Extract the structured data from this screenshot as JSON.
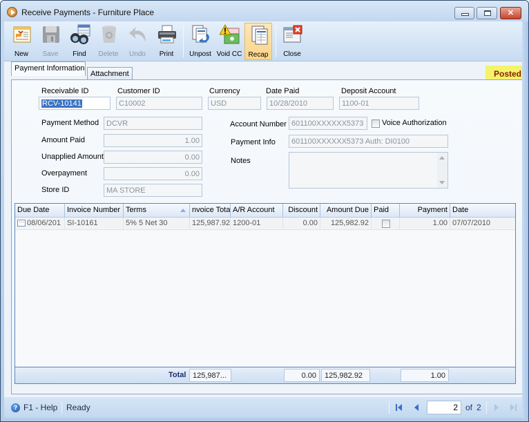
{
  "window": {
    "title": "Receive Payments - Furniture Place",
    "buttons": {
      "minimize": "minimize",
      "maximize": "maximize",
      "close": "close"
    }
  },
  "toolbar": {
    "items": [
      {
        "label": "New",
        "icon": "new-icon",
        "enabled": true
      },
      {
        "label": "Save",
        "icon": "save-icon",
        "enabled": false
      },
      {
        "label": "Find",
        "icon": "find-binoculars-icon",
        "enabled": true
      },
      {
        "label": "Delete",
        "icon": "delete-trash-icon",
        "enabled": false
      },
      {
        "label": "Undo",
        "icon": "undo-icon",
        "enabled": false
      },
      {
        "label": "Print",
        "icon": "print-icon",
        "enabled": true
      },
      {
        "label": "Unpost",
        "icon": "unpost-icon",
        "enabled": true
      },
      {
        "label": "Void CC",
        "icon": "void-cc-warning-icon",
        "enabled": true
      },
      {
        "label": "Recap",
        "icon": "recap-icon",
        "enabled": true,
        "active": true
      },
      {
        "label": "Close",
        "icon": "close-form-icon",
        "enabled": true
      }
    ]
  },
  "tabs": [
    {
      "label": "Payment Information",
      "selected": true
    },
    {
      "label": "Attachment",
      "selected": false
    }
  ],
  "status_badge": "Posted",
  "form": {
    "receivable_id": {
      "label": "Receivable ID",
      "value": "RCV-10141"
    },
    "customer_id": {
      "label": "Customer ID",
      "value": "C10002"
    },
    "currency": {
      "label": "Currency",
      "value": "USD"
    },
    "date_paid": {
      "label": "Date Paid",
      "value": "10/28/2010"
    },
    "deposit_account": {
      "label": "Deposit Account",
      "value": "1100-01"
    },
    "payment_method": {
      "label": "Payment Method",
      "value": "DCVR"
    },
    "amount_paid": {
      "label": "Amount Paid",
      "value": "1.00"
    },
    "unapplied_amount": {
      "label": "Unapplied Amount",
      "value": "0.00"
    },
    "overpayment": {
      "label": "Overpayment",
      "value": "0.00"
    },
    "store_id": {
      "label": "Store ID",
      "value": "MA STORE"
    },
    "account_number": {
      "label": "Account Number",
      "value": "601100XXXXXX5373"
    },
    "voice_authorization": {
      "label": "Voice Authorization",
      "checked": false
    },
    "payment_info": {
      "label": "Payment Info",
      "value": "601100XXXXXX5373 Auth: DI0100"
    },
    "notes": {
      "label": "Notes",
      "value": ""
    }
  },
  "grid": {
    "columns": [
      "Due Date",
      "Invoice Number",
      "Terms",
      "nvoice Total",
      "A/R Account",
      "Discount",
      "Amount Due",
      "Paid",
      "Payment",
      "Date"
    ],
    "rows": [
      {
        "due_date": "08/06/201",
        "invoice_number": "SI-10161",
        "terms": "5% 5 Net 30",
        "invoice_total": "125,987.92",
        "ar_account": "1200-01",
        "discount": "0.00",
        "amount_due": "125,982.92",
        "paid": false,
        "payment": "1.00",
        "date": "07/07/2010"
      }
    ],
    "totals": {
      "label": "Total",
      "invoice_total": "125,987...",
      "discount": "0.00",
      "amount_due": "125,982.92",
      "payment": "1.00"
    }
  },
  "statusbar": {
    "help": "F1 - Help",
    "status": "Ready",
    "page_current": "2",
    "page_of": "of",
    "page_total": "2"
  }
}
